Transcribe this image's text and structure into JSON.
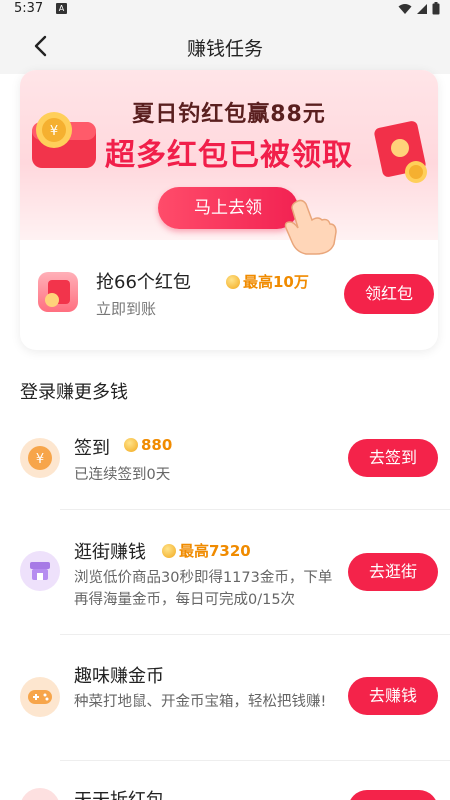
{
  "status_bar": {
    "time": "5:37",
    "notif": "A"
  },
  "header": {
    "title": "赚钱任务"
  },
  "banner": {
    "line1": "夏日钓红包赢88元",
    "line2": "超多红包已被领取",
    "cta": "马上去领"
  },
  "redpack_task": {
    "title": "抢66个红包",
    "reward": "最高10万",
    "subtitle": "立即到账",
    "button": "领红包"
  },
  "section": {
    "title": "登录赚更多钱"
  },
  "tasks": [
    {
      "title": "签到",
      "reward": "880",
      "desc": "已连续签到0天",
      "button": "去签到",
      "icon": "yuan-coin-icon",
      "icon_bg": "#fde6cf"
    },
    {
      "title": "逛街赚钱",
      "reward": "最高7320",
      "desc": "浏览低价商品30秒即得1173金币，下单再得海量金币，每日可完成0/15次",
      "button": "去逛街",
      "icon": "shop-icon",
      "icon_bg": "#eee1fb"
    },
    {
      "title": "趣味赚金币",
      "reward": "",
      "desc": "种菜打地鼠、开金币宝箱，轻松把钱赚!",
      "button": "去赚钱",
      "icon": "gamepad-icon",
      "icon_bg": "#fde6cf"
    },
    {
      "title": "天天拆红包",
      "reward": "",
      "desc": "",
      "button": "",
      "icon": "redpack-icon",
      "icon_bg": "#fde0e0"
    }
  ],
  "colors": {
    "accent": "#f4234a",
    "coin_text": "#f08b00"
  }
}
